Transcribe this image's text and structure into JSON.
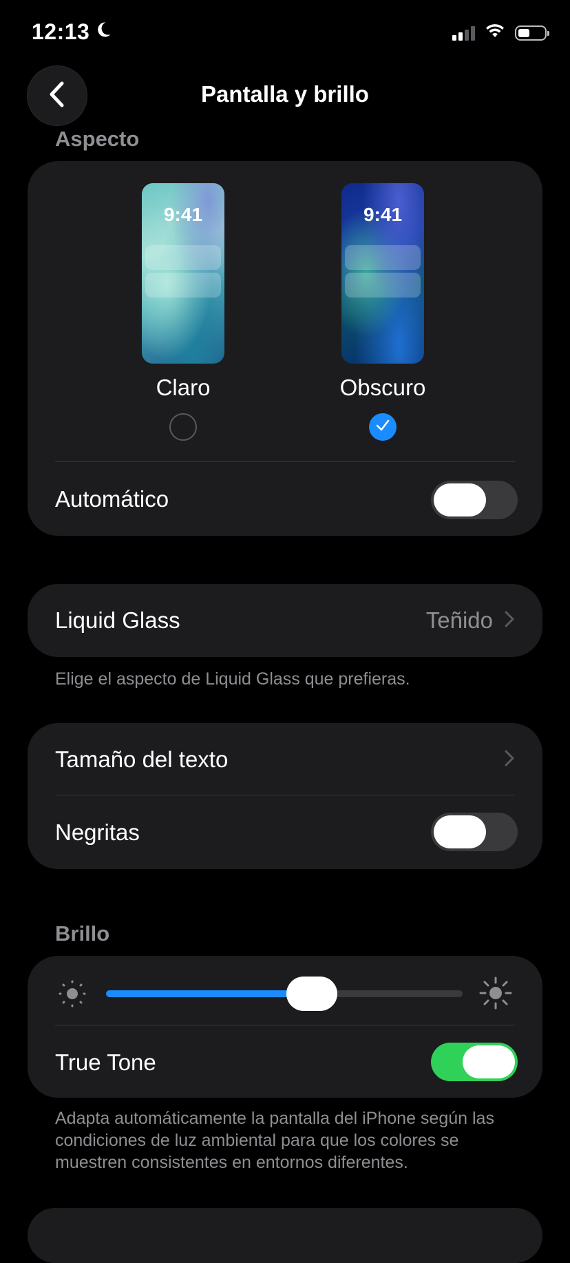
{
  "status_bar": {
    "time": "12:13",
    "icons": [
      "moon-icon",
      "signal-icon",
      "wifi-icon",
      "battery-icon"
    ]
  },
  "nav": {
    "title": "Pantalla y brillo",
    "back_icon": "chevron-left-icon"
  },
  "appearance": {
    "header": "Aspecto",
    "light": {
      "label": "Claro",
      "preview_time": "9:41",
      "selected": false
    },
    "dark": {
      "label": "Obscuro",
      "preview_time": "9:41",
      "selected": true
    },
    "automatic": {
      "label": "Automático",
      "on": false
    }
  },
  "liquid_glass": {
    "label": "Liquid Glass",
    "value": "Teñido",
    "footnote": "Elige el aspecto de Liquid Glass que prefieras."
  },
  "text_settings": {
    "text_size_label": "Tamaño del texto",
    "bold": {
      "label": "Negritas",
      "on": false
    }
  },
  "brightness": {
    "header": "Brillo",
    "level_fraction": 0.59,
    "true_tone": {
      "label": "True Tone",
      "on": true
    },
    "footnote": "Adapta automáticamente la pantalla del iPhone según las condiciones de luz ambiental para que los colores se muestren consistentes en entornos diferentes."
  },
  "colors": {
    "accent": "#1a8cff",
    "toggle_on": "#30d158",
    "card_bg": "#1c1c1e",
    "secondary_text": "#8e8e93"
  }
}
